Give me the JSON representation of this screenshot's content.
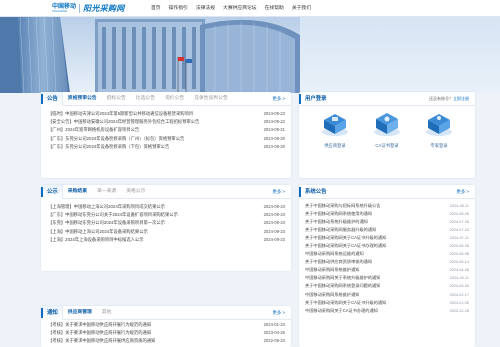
{
  "brand": {
    "cm_cn": "中国移动",
    "cm_en": "China Mobile",
    "title": "阳光采购网",
    "accent": "#0b6cc0"
  },
  "nav": [
    "首页",
    "操作指引",
    "法律法规",
    "大赛供应商论坛",
    "在线帮助",
    "关于我们"
  ],
  "announcements": {
    "tabs": [
      "公告",
      "资格预审公告",
      "招标公告",
      "比选公告",
      "询价公告",
      "竞争性谈判公告"
    ],
    "more": "更多 >",
    "rows": [
      {
        "title": "【临时】中国移动天津公司2024年第5期新型公共移动通信设备租赁采购项目",
        "date": "2024-09-23"
      },
      {
        "title": "【安全公告】中国移动安徽公司2024年经营管理服务外包综合工程招标预审公告",
        "date": "2024-09-22"
      },
      {
        "title": "【广州】2024年宽带网络机房设备扩容项目公告",
        "date": "2024-09-21"
      },
      {
        "title": "【广东】东莞分公司2024年设备检修采购（广州）（标包）资格预审公告",
        "date": "2024-09-20"
      },
      {
        "title": "【广东】东莞分公司2024年设备检修采购（下包）资格预审公告",
        "date": "2024-09-20"
      }
    ]
  },
  "results": {
    "tabs": [
      "公示",
      "采购结果",
      "单一来源",
      "资格公示"
    ],
    "more": "更多 >",
    "rows": [
      {
        "title": "【上海管理】中国移动上海公司2024年采购项目成交结果公示",
        "date": "2024-09-23",
        "dim": false
      },
      {
        "title": "【广东】中国移动东莞分公司关于2024年设备扩容项目采购结果公示",
        "date": "2024-09-23",
        "dim": false
      },
      {
        "title": "【东莞】中国移动东莞分公司2024年设备采购项目第一次公示",
        "date": "2024-09-23",
        "dim": false
      },
      {
        "title": "【上海】中国移动上海公司2024年设备采购结果公示",
        "date": "2024-09-23",
        "dim": false
      },
      {
        "title": "【上海】2024年上海设备采购项目中标候选人公示",
        "date": "2024-09-23",
        "dim": false
      }
    ]
  },
  "supplier": {
    "tabs": [
      "通知",
      "供应商管理",
      "其他"
    ],
    "more": "更多 >",
    "rows": [
      {
        "title": "【考核】关于要求中国移动供应商开展行为规范的通知",
        "date": "2024-01-23",
        "dim": false
      },
      {
        "title": "【考核】关于要求中国移动供应商开展行为规范的通知",
        "date": "2023-04-25",
        "dim": false
      },
      {
        "title": "【考核】关于要求中国移动供应商开展供应商资质的通知",
        "date": "2022-09-23",
        "dim": false
      },
      {
        "title": "【考核】关于要求中国移动供应商开展供应商资质的通知",
        "date": "2022-07-09",
        "dim": true
      }
    ]
  },
  "login": {
    "title": "用户登录",
    "extra_prefix": "还没有账号？",
    "extra_link": "立即注册",
    "options": [
      {
        "label": "供应商登录",
        "icon": "supplier-login-icon"
      },
      {
        "label": "CA证书登录",
        "icon": "ca-login-icon"
      },
      {
        "label": "专家登录",
        "icon": "expert-login-icon"
      }
    ]
  },
  "system_notice": {
    "title": "系统公告",
    "more": "更多 >",
    "rows": [
      {
        "title": "关于中国移动采购与招标网系统升级公告",
        "date": "2024-08-11"
      },
      {
        "title": "关于中国移动采购网系统使用的通知",
        "date": "2024-08-06"
      },
      {
        "title": "关于中国移动系统升级维护的通知",
        "date": "2024-07-25"
      },
      {
        "title": "关于中国移动采购网服务器升级的通知",
        "date": "2024-07-23"
      },
      {
        "title": "关于中国移动采购网关于CA证书升级的通知",
        "date": "2024-07-11"
      },
      {
        "title": "关于中国移动采购网关于CA证书办理的通知",
        "date": "2024-06-25"
      },
      {
        "title": "中国移动采购网系统运维的通知",
        "date": "2024-06-08"
      },
      {
        "title": "关于中国移动供应商资质审核的通知",
        "date": "2024-05-14"
      },
      {
        "title": "中国移动采购网系统维护通知",
        "date": "2024-04-28"
      },
      {
        "title": "中国移动采购网关于系统升级维护的通知",
        "date": "2024-04-11"
      },
      {
        "title": "关于中国移动采购网系统登录问题的通知",
        "date": "2024-03-20"
      },
      {
        "title": "中国移动采购网系统维护通知",
        "date": "2024-02-17"
      },
      {
        "title": "关于中国移动采购网关于CA证书升级的通知",
        "date": "2024-01-05"
      },
      {
        "title": "中国移动采购网关于CA证书办理的通知",
        "date": "2023-12-28"
      }
    ]
  }
}
